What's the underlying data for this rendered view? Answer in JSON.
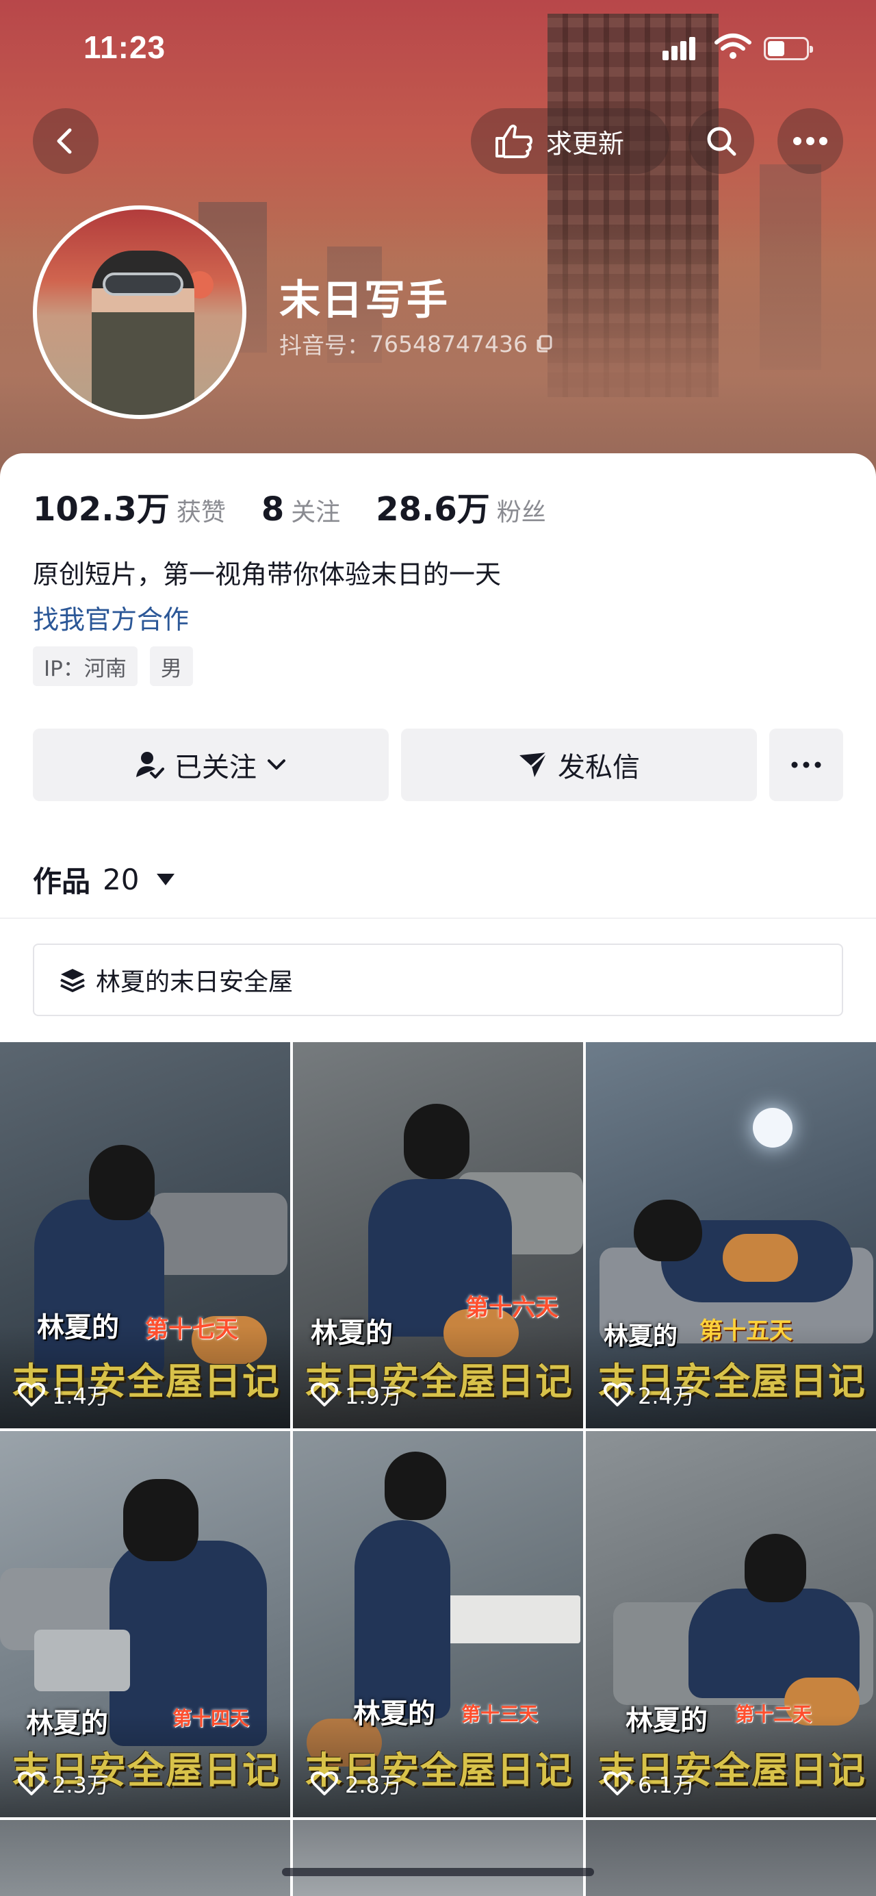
{
  "status_bar": {
    "time": "11:23",
    "battery_fraction": 0.45
  },
  "header": {
    "request_update_label": "求更新",
    "name": "末日写手",
    "douyin_id_label": "抖音号：",
    "douyin_id": "76548747436"
  },
  "stats": [
    {
      "value": "102.3万",
      "label": "获赞"
    },
    {
      "value": "8",
      "label": "关注"
    },
    {
      "value": "28.6万",
      "label": "粉丝"
    }
  ],
  "bio": "原创短片，第一视角带你体验末日的一天",
  "business_link": "找我官方合作",
  "tags": [
    "IP：河南",
    "男"
  ],
  "actions": {
    "follow_label": "已关注",
    "message_label": "发私信"
  },
  "works": {
    "label": "作品",
    "count": "20"
  },
  "collection": {
    "title": "林夏的末日安全屋"
  },
  "videos": [
    {
      "name": "林夏的",
      "day": "第十七天",
      "title": "末日安全屋日记",
      "likes": "1.4万"
    },
    {
      "name": "林夏的",
      "day": "第十六天",
      "title": "末日安全屋日记",
      "likes": "1.9万"
    },
    {
      "name": "林夏的",
      "day": "第十五天",
      "title": "末日安全屋日记",
      "likes": "2.4万"
    },
    {
      "name": "林夏的",
      "day": "第十四天",
      "title": "末日安全屋日记",
      "likes": "2.3万"
    },
    {
      "name": "林夏的",
      "day": "第十三天",
      "title": "末日安全屋日记",
      "likes": "2.8万"
    },
    {
      "name": "林夏的",
      "day": "第十二天",
      "title": "末日安全屋日记",
      "likes": "6.1万"
    }
  ],
  "colors": {
    "accent_link": "#2b5797",
    "title_gold": "#d8c24a",
    "day_red": "#ff4f2e"
  }
}
